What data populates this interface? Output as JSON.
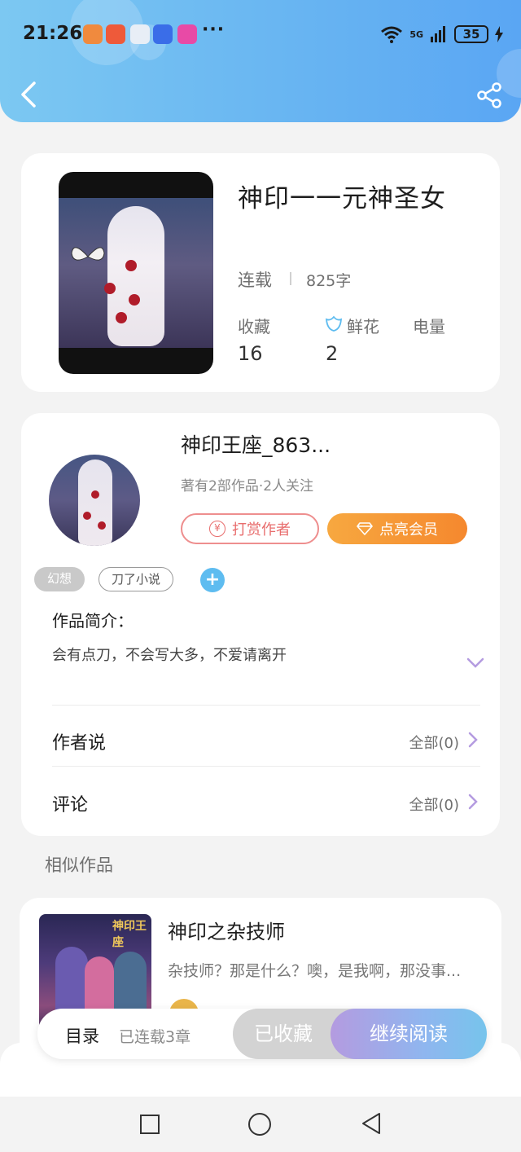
{
  "status_bar": {
    "time": "21:26",
    "network": "5G",
    "battery": "35",
    "more": "···"
  },
  "nav": {
    "back_icon": "chevron-left-icon",
    "share_icon": "share-icon"
  },
  "book": {
    "title": "神印一一元神圣女",
    "status": "连载",
    "word_count": "825字",
    "stats": [
      {
        "label": "收藏",
        "value": "16"
      },
      {
        "label": "鲜花",
        "value": "2"
      },
      {
        "label": "电量",
        "value": ""
      }
    ]
  },
  "author": {
    "name": "神印王座_863...",
    "meta": "著有2部作品·2人关注",
    "tip_button": "打赏作者",
    "vip_button": "点亮会员"
  },
  "tags": [
    "幻想",
    "刀了小说"
  ],
  "intro": {
    "label": "作品简介：",
    "text": "会有点刀，不会写大多，不爱请离开"
  },
  "rows": [
    {
      "label": "作者说",
      "right": "全部(0)"
    },
    {
      "label": "评论",
      "right": "全部(0)"
    }
  ],
  "similar": {
    "title": "相似作品",
    "item": {
      "title": "神印之杂技师",
      "desc": "杂技师？那是什么？噢，是我啊，那没事...",
      "cover_text": "神印王座"
    }
  },
  "action_bar": {
    "toc": "目录",
    "serial": "已连载3章",
    "collected": "已收藏",
    "continue": "继续阅读"
  },
  "colors": {
    "header": "#6ab7f2",
    "accent_purple": "#b49be0",
    "vip_orange": "#f5882e",
    "tip_red": "#e86d6d"
  }
}
